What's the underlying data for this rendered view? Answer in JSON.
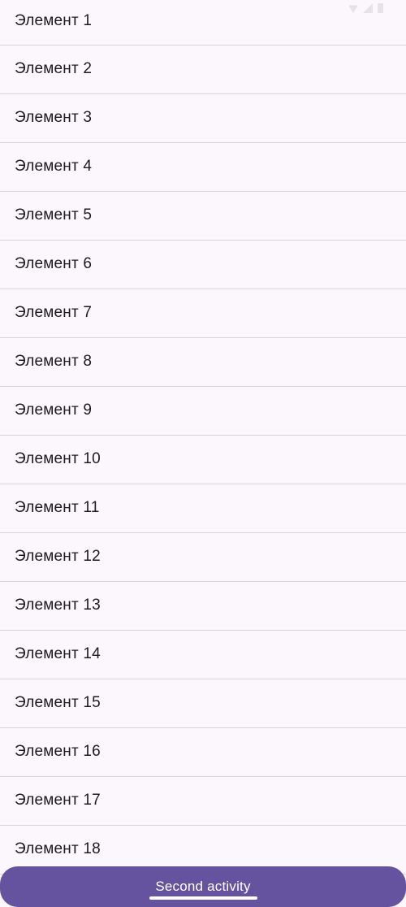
{
  "list": {
    "items": [
      {
        "label": "Элемент 1"
      },
      {
        "label": "Элемент 2"
      },
      {
        "label": "Элемент 3"
      },
      {
        "label": "Элемент 4"
      },
      {
        "label": "Элемент 5"
      },
      {
        "label": "Элемент 6"
      },
      {
        "label": "Элемент 7"
      },
      {
        "label": "Элемент 8"
      },
      {
        "label": "Элемент 9"
      },
      {
        "label": "Элемент 10"
      },
      {
        "label": "Элемент 11"
      },
      {
        "label": "Элемент 12"
      },
      {
        "label": "Элемент 13"
      },
      {
        "label": "Элемент 14"
      },
      {
        "label": "Элемент 15"
      },
      {
        "label": "Элемент 16"
      },
      {
        "label": "Элемент 17"
      },
      {
        "label": "Элемент 18"
      }
    ]
  },
  "bottom_button": {
    "label": "Second activity"
  },
  "colors": {
    "background": "#fcf7fc",
    "divider": "#d9d4da",
    "text": "#1d1b20",
    "accent": "#65539f"
  }
}
